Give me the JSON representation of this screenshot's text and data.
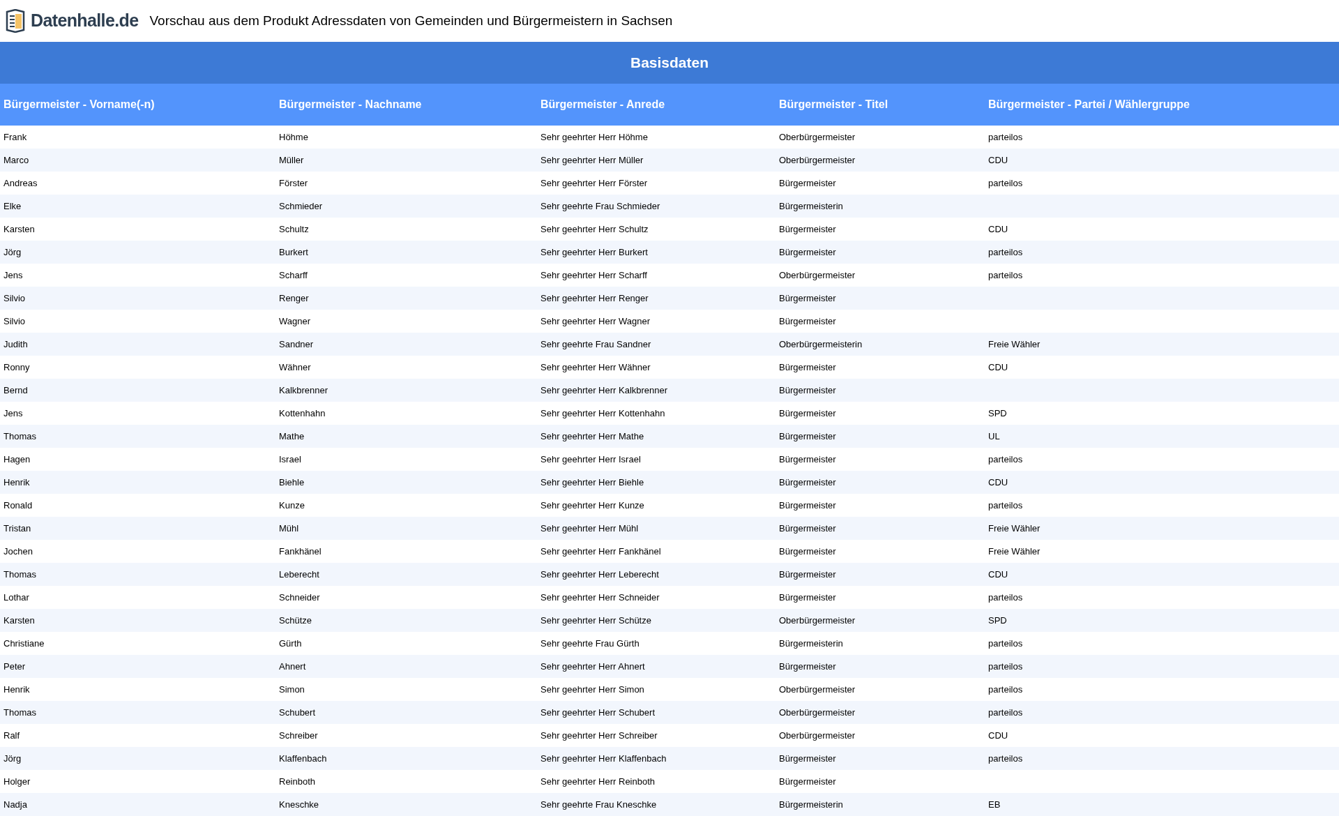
{
  "header": {
    "logo_text": "Datenhalle.de",
    "title": "Vorschau aus dem Produkt Adressdaten von Gemeinden und Bürgermeistern in Sachsen"
  },
  "table": {
    "group_heading": "Basisdaten",
    "columns": [
      "Bürgermeister - Vorname(-n)",
      "Bürgermeister - Nachname",
      "Bürgermeister - Anrede",
      "Bürgermeister - Titel",
      "Bürgermeister - Partei / Wählergruppe"
    ],
    "rows": [
      {
        "first": "Frank",
        "last": "Höhme",
        "salutation": "Sehr geehrter Herr Höhme",
        "title": "Oberbürgermeister",
        "party": "parteilos"
      },
      {
        "first": "Marco",
        "last": "Müller",
        "salutation": "Sehr geehrter Herr Müller",
        "title": "Oberbürgermeister",
        "party": "CDU"
      },
      {
        "first": "Andreas",
        "last": "Förster",
        "salutation": "Sehr geehrter Herr Förster",
        "title": "Bürgermeister",
        "party": "parteilos"
      },
      {
        "first": "Elke",
        "last": "Schmieder",
        "salutation": "Sehr geehrte Frau Schmieder",
        "title": "Bürgermeisterin"
      },
      {
        "first": "Karsten",
        "last": "Schultz",
        "salutation": "Sehr geehrter Herr Schultz",
        "title": "Bürgermeister",
        "party": "CDU"
      },
      {
        "first": "Jörg",
        "last": "Burkert",
        "salutation": "Sehr geehrter Herr Burkert",
        "title": "Bürgermeister",
        "party": "parteilos"
      },
      {
        "first": "Jens",
        "last": "Scharff",
        "salutation": "Sehr geehrter Herr Scharff",
        "title": "Oberbürgermeister",
        "party": "parteilos"
      },
      {
        "first": "Silvio",
        "last": "Renger",
        "salutation": "Sehr geehrter Herr Renger",
        "title": "Bürgermeister"
      },
      {
        "first": "Silvio",
        "last": "Wagner",
        "salutation": "Sehr geehrter Herr Wagner",
        "title": "Bürgermeister"
      },
      {
        "first": "Judith",
        "last": "Sandner",
        "salutation": "Sehr geehrte Frau Sandner",
        "title": "Oberbürgermeisterin",
        "party": "Freie Wähler"
      },
      {
        "first": "Ronny",
        "last": "Wähner",
        "salutation": "Sehr geehrter Herr Wähner",
        "title": "Bürgermeister",
        "party": "CDU"
      },
      {
        "first": "Bernd",
        "last": "Kalkbrenner",
        "salutation": "Sehr geehrter Herr Kalkbrenner",
        "title": "Bürgermeister"
      },
      {
        "first": "Jens",
        "last": "Kottenhahn",
        "salutation": "Sehr geehrter Herr Kottenhahn",
        "title": "Bürgermeister",
        "party": "SPD"
      },
      {
        "first": "Thomas",
        "last": "Mathe",
        "salutation": "Sehr geehrter Herr Mathe",
        "title": "Bürgermeister",
        "party": "UL"
      },
      {
        "first": "Hagen",
        "last": "Israel",
        "salutation": "Sehr geehrter Herr Israel",
        "title": "Bürgermeister",
        "party": "parteilos"
      },
      {
        "first": "Henrik",
        "last": "Biehle",
        "salutation": "Sehr geehrter Herr Biehle",
        "title": "Bürgermeister",
        "party": "CDU"
      },
      {
        "first": "Ronald",
        "last": "Kunze",
        "salutation": "Sehr geehrter Herr Kunze",
        "title": "Bürgermeister",
        "party": "parteilos"
      },
      {
        "first": "Tristan",
        "last": "Mühl",
        "salutation": "Sehr geehrter Herr Mühl",
        "title": "Bürgermeister",
        "party": "Freie Wähler"
      },
      {
        "first": "Jochen",
        "last": "Fankhänel",
        "salutation": "Sehr geehrter Herr Fankhänel",
        "title": "Bürgermeister",
        "party": "Freie Wähler"
      },
      {
        "first": "Thomas",
        "last": "Leberecht",
        "salutation": "Sehr geehrter Herr Leberecht",
        "title": "Bürgermeister",
        "party": "CDU"
      },
      {
        "first": "Lothar",
        "last": "Schneider",
        "salutation": "Sehr geehrter Herr Schneider",
        "title": "Bürgermeister",
        "party": "parteilos"
      },
      {
        "first": "Karsten",
        "last": "Schütze",
        "salutation": "Sehr geehrter Herr Schütze",
        "title": "Oberbürgermeister",
        "party": "SPD"
      },
      {
        "first": "Christiane",
        "last": "Gürth",
        "salutation": "Sehr geehrte Frau Gürth",
        "title": "Bürgermeisterin",
        "party": "parteilos"
      },
      {
        "first": "Peter",
        "last": "Ahnert",
        "salutation": "Sehr geehrter Herr Ahnert",
        "title": "Bürgermeister",
        "party": "parteilos"
      },
      {
        "first": "Henrik",
        "last": "Simon",
        "salutation": "Sehr geehrter Herr Simon",
        "title": "Oberbürgermeister",
        "party": "parteilos"
      },
      {
        "first": "Thomas",
        "last": "Schubert",
        "salutation": "Sehr geehrter Herr Schubert",
        "title": "Oberbürgermeister",
        "party": "parteilos"
      },
      {
        "first": "Ralf",
        "last": "Schreiber",
        "salutation": "Sehr geehrter Herr Schreiber",
        "title": "Oberbürgermeister",
        "party": "CDU"
      },
      {
        "first": "Jörg",
        "last": "Klaffenbach",
        "salutation": "Sehr geehrter Herr Klaffenbach",
        "title": "Bürgermeister",
        "party": "parteilos"
      },
      {
        "first": "Holger",
        "last": "Reinboth",
        "salutation": "Sehr geehrter Herr Reinboth",
        "title": "Bürgermeister"
      },
      {
        "first": "Nadja",
        "last": "Kneschke",
        "salutation": "Sehr geehrte Frau Kneschke",
        "title": "Bürgermeisterin",
        "party": "EB"
      }
    ]
  }
}
